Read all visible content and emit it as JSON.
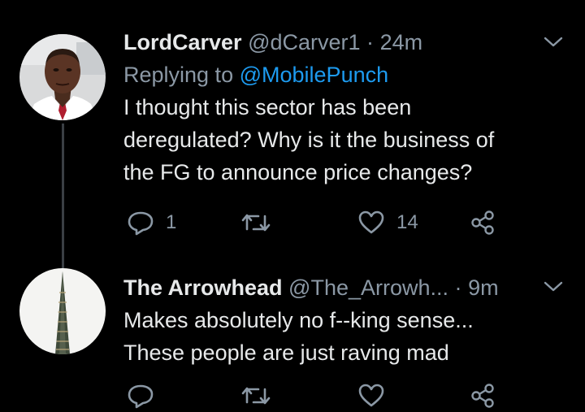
{
  "colors": {
    "background": "#000000",
    "text_primary": "#e7e9ea",
    "text_secondary": "#8b98a5",
    "link": "#1d9bf0",
    "thread_line": "#3a3f44"
  },
  "tweets": [
    {
      "name": "LordCarver",
      "handle": "@dCarver1",
      "separator": "·",
      "time": "24m",
      "replying_prefix": "Replying to",
      "replying_to": "@MobilePunch",
      "lines": [
        "I thought this sector has been",
        "deregulated? Why is it the business of",
        "the FG to announce price changes?"
      ],
      "reply_count": "1",
      "retweet_count": "",
      "like_count": "14",
      "avatar_icon": "user-photo-avatar"
    },
    {
      "name": "The Arrowhead",
      "handle": "@The_Arrowh...",
      "separator": "·",
      "time": "9m",
      "lines": [
        "Makes absolutely no f--king sense...",
        "These people are just raving mad"
      ],
      "reply_count": "",
      "retweet_count": "",
      "like_count": "",
      "avatar_icon": "tower-avatar"
    }
  ],
  "icons": {
    "reply": "reply-icon",
    "retweet": "retweet-icon",
    "like": "like-icon",
    "share": "share-icon",
    "menu": "chevron-down-icon"
  }
}
